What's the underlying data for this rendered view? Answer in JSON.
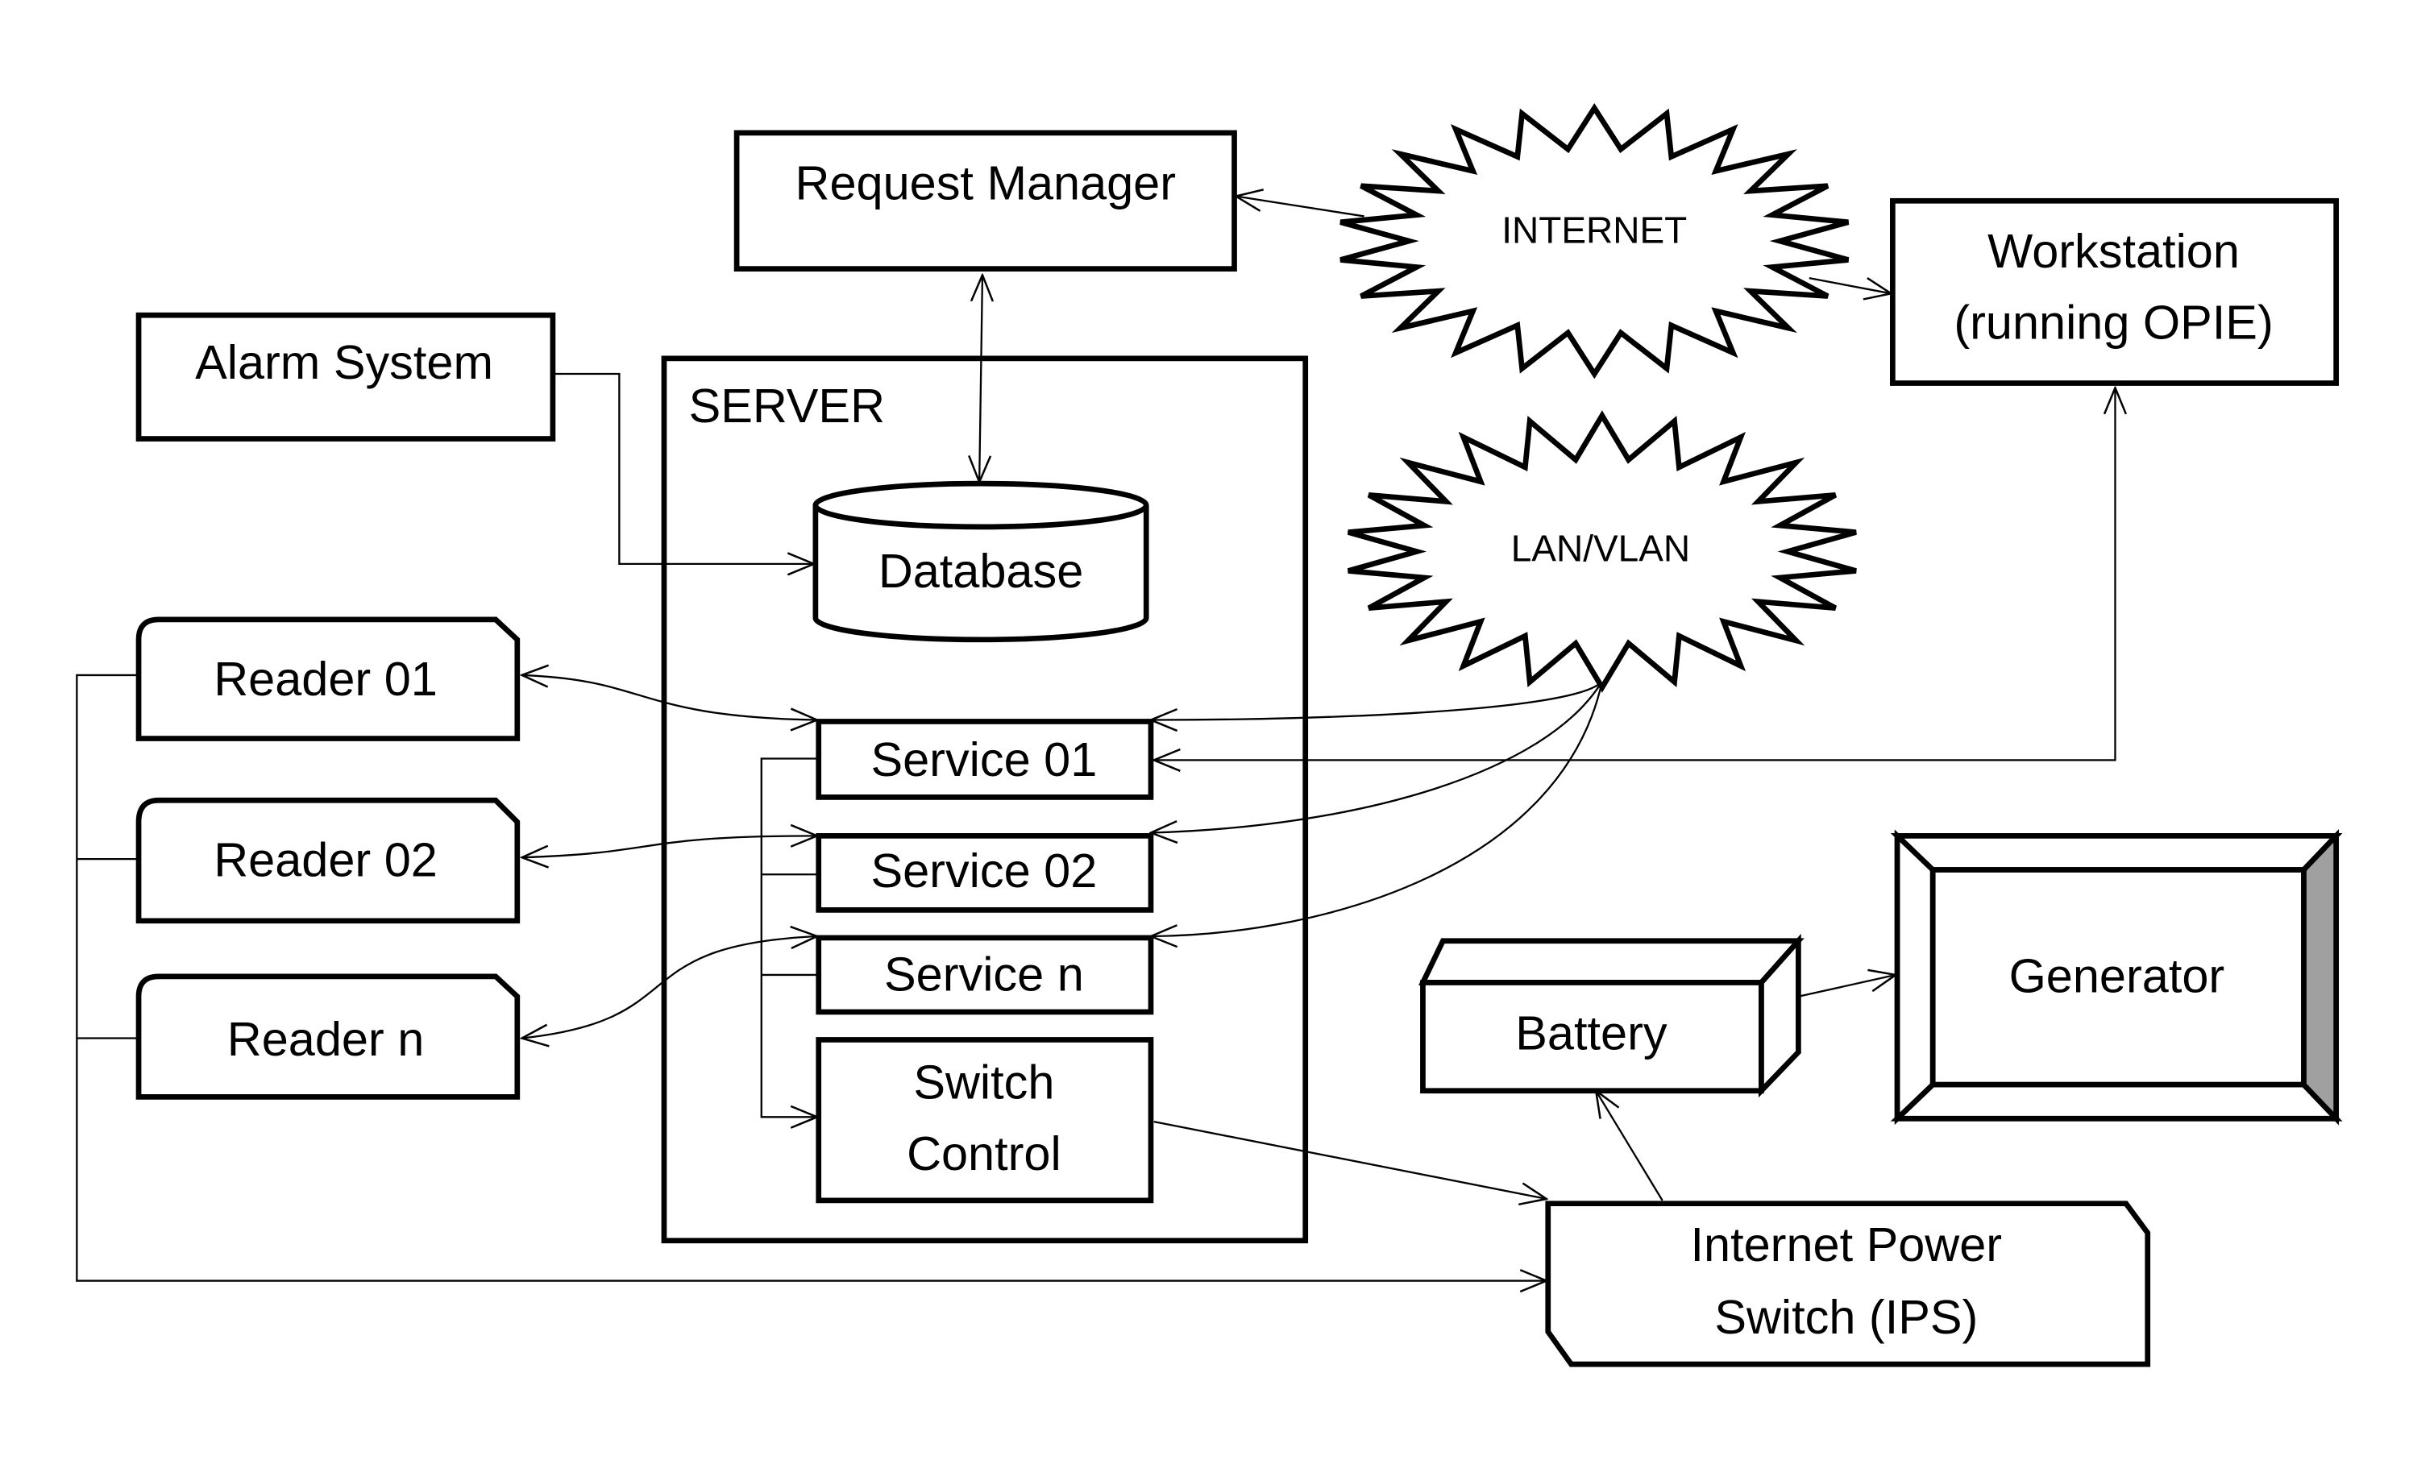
{
  "diagram": {
    "nodes": {
      "request_manager": "Request Manager",
      "internet": "INTERNET",
      "workstation_line1": "Workstation",
      "workstation_line2": "(running OPIE)",
      "alarm_system": "Alarm System",
      "server": "SERVER",
      "database": "Database",
      "lan_vlan": "LAN/VLAN",
      "reader_01": "Reader 01",
      "reader_02": "Reader 02",
      "reader_n": "Reader n",
      "service_01": "Service 01",
      "service_02": "Service 02",
      "service_n": "Service n",
      "switch_control_line1": "Switch",
      "switch_control_line2": "Control",
      "battery": "Battery",
      "generator": "Generator",
      "ips_line1": "Internet Power",
      "ips_line2": "Switch (IPS)"
    },
    "colors": {
      "stroke": "#000000",
      "fill": "#ffffff",
      "generator_shade": "#a0a0a0"
    },
    "connections": [
      {
        "from": "Request Manager",
        "to": "INTERNET",
        "arrow": "start"
      },
      {
        "from": "INTERNET",
        "to": "Workstation (running OPIE)",
        "arrow": "end"
      },
      {
        "from": "Request Manager",
        "to": "Database",
        "arrow": "both"
      },
      {
        "from": "Alarm System",
        "to": "Database",
        "arrow": "end"
      },
      {
        "from": "Reader 01",
        "to": "Service 01",
        "arrow": "both"
      },
      {
        "from": "Reader 02",
        "to": "Service 02",
        "arrow": "both"
      },
      {
        "from": "Reader n",
        "to": "Service n",
        "arrow": "both"
      },
      {
        "from": "LAN/VLAN",
        "to": "Service 01",
        "arrow": "end"
      },
      {
        "from": "LAN/VLAN",
        "to": "Service 02",
        "arrow": "end"
      },
      {
        "from": "LAN/VLAN",
        "to": "Service n",
        "arrow": "end"
      },
      {
        "from": "Workstation (running OPIE)",
        "to": "Service 01",
        "arrow": "both"
      },
      {
        "from": "Service 01",
        "to": "Switch Control",
        "arrow": "end"
      },
      {
        "from": "Switch Control",
        "to": "Internet Power Switch (IPS)",
        "arrow": "end"
      },
      {
        "from": "Readers",
        "to": "Internet Power Switch (IPS)",
        "arrow": "end"
      },
      {
        "from": "Internet Power Switch (IPS)",
        "to": "Battery",
        "arrow": "end"
      },
      {
        "from": "Battery",
        "to": "Generator",
        "arrow": "end"
      }
    ]
  }
}
